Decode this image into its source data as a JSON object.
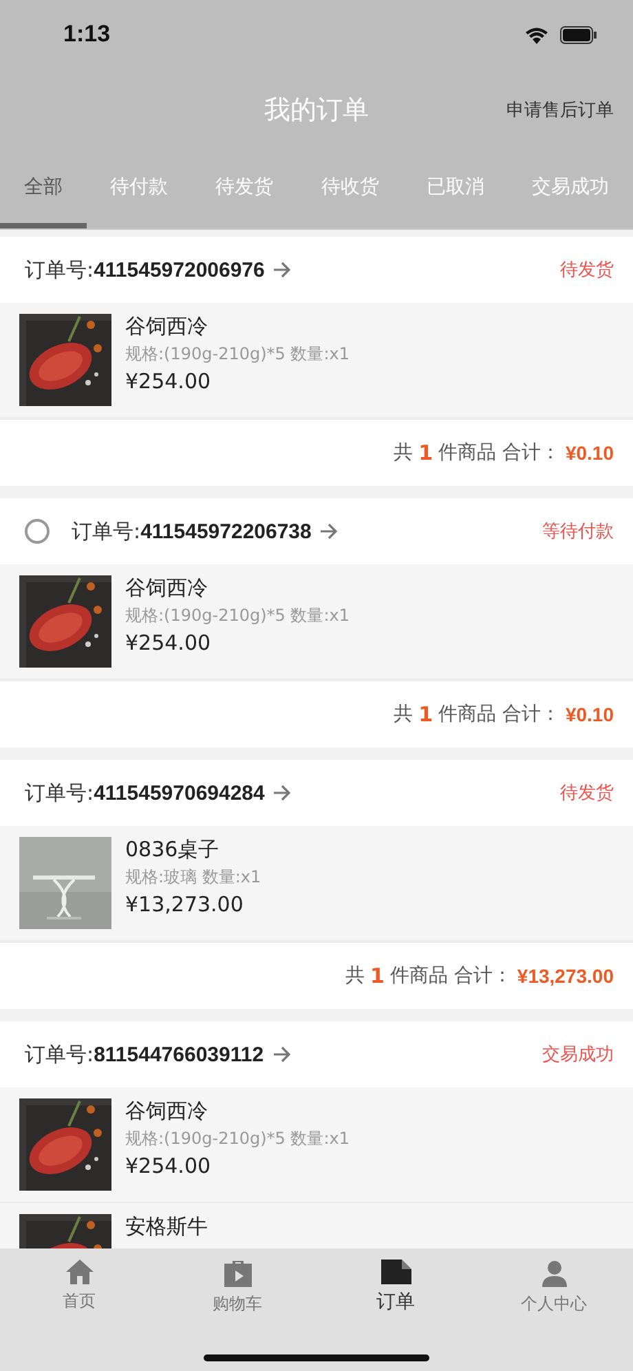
{
  "status_bar": {
    "time": "1:13"
  },
  "nav": {
    "title": "我的订单",
    "action": "申请售后订单"
  },
  "tabs": [
    {
      "label": "全部",
      "selected": true
    },
    {
      "label": "待付款",
      "selected": false
    },
    {
      "label": "待发货",
      "selected": false
    },
    {
      "label": "待收货",
      "selected": false
    },
    {
      "label": "已取消",
      "selected": false
    },
    {
      "label": "交易成功",
      "selected": false
    }
  ],
  "orders": [
    {
      "number_label": "订单号:",
      "number": "411545972006976",
      "status": "待发货",
      "items": [
        {
          "name": "谷饲西冷",
          "spec": "规格:(190g-210g)*5 数量:x1",
          "price": "¥254.00"
        }
      ],
      "footer": {
        "prefix": "共",
        "count": "1",
        "suffix": "件商品 合计：",
        "total": "¥0.10"
      }
    },
    {
      "checkbox": {
        "checked": false
      },
      "number_label": "订单号:",
      "number": "411545972206738",
      "status": "等待付款",
      "items": [
        {
          "name": "谷饲西冷",
          "spec": "规格:(190g-210g)*5 数量:x1",
          "price": "¥254.00"
        }
      ],
      "footer": {
        "prefix": "共",
        "count": "1",
        "suffix": "件商品 合计：",
        "total": "¥0.10"
      }
    },
    {
      "number_label": "订单号:",
      "number": "411545970694284",
      "status": "待发货",
      "items": [
        {
          "name": "0836桌子",
          "spec": "规格:玻璃 数量:x1",
          "price": "¥13,273.00"
        }
      ],
      "footer": {
        "prefix": "共",
        "count": "1",
        "suffix": "件商品 合计：",
        "total": "¥13,273.00"
      }
    },
    {
      "number_label": "订单号:",
      "number": "811544766039112",
      "status": "交易成功",
      "items": [
        {
          "name": "谷饲西冷",
          "spec": "规格:(190g-210g)*5 数量:x1",
          "price": "¥254.00"
        },
        {
          "name": "安格斯牛"
        }
      ]
    }
  ],
  "tab_bar": [
    {
      "label": "首页",
      "kind": "home",
      "selected": false
    },
    {
      "label": "购物车",
      "kind": "cart",
      "selected": false
    },
    {
      "label": "订单",
      "kind": "orders",
      "selected": true
    },
    {
      "label": "个人中心",
      "kind": "profile",
      "selected": false
    }
  ]
}
